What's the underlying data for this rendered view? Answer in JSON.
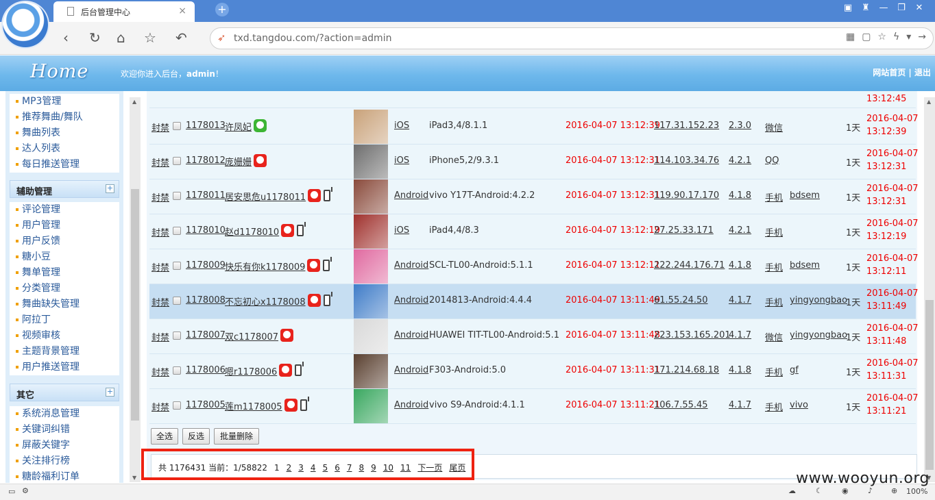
{
  "browser": {
    "tab_title": "后台管理中心",
    "tab_close": "×",
    "new_tab": "+",
    "url": "txd.tangdou.com/?action=admin",
    "zoom": "100%"
  },
  "header": {
    "home": "Home",
    "welcome_prefix": "欢迎你进入后台，",
    "user": "admin",
    "welcome_suffix": "！",
    "links": "网站首页 | 退出"
  },
  "sidebar": {
    "group1_items": [
      "MP3管理",
      "推荐舞曲/舞队",
      "舞曲列表",
      "达人列表",
      "每日推送管理"
    ],
    "group2_title": "辅助管理",
    "group2_items": [
      "评论管理",
      "用户管理",
      "用户反馈",
      "糖小豆",
      "舞单管理",
      "分类管理",
      "舞曲缺失管理",
      "阿拉丁",
      "视频审核",
      "主题背景管理",
      "用户推送管理"
    ],
    "group3_title": "其它",
    "group3_items": [
      "系统消息管理",
      "关键词纠错",
      "屏蔽关键字",
      "关注排行榜",
      "糖龄福利订单"
    ]
  },
  "table": {
    "ban_label": "封禁",
    "days": "1天",
    "top_time": "13:12:45",
    "rows": [
      {
        "id": "1178013",
        "name": "许凤妃",
        "badge": "wechat",
        "phone": false,
        "os": "iOS",
        "device": "iPad3,4/8.1.1",
        "time": "2016-04-07 13:12:39",
        "ip": "117.31.152.23",
        "ver": "2.3.0",
        "login": "微信",
        "channel": "",
        "date": "2016-04-07",
        "clock": "13:12:39",
        "avatar": "#c9a27a",
        "selected": false
      },
      {
        "id": "1178012",
        "name": "庞姗姗",
        "badge": "qq",
        "phone": false,
        "os": "iOS",
        "device": "iPhone5,2/9.3.1",
        "time": "2016-04-07 13:12:31",
        "ip": "114.103.34.76",
        "ver": "4.2.1",
        "login": "QQ",
        "channel": "",
        "date": "2016-04-07",
        "clock": "13:12:31",
        "avatar": "#6e6e6e",
        "selected": false
      },
      {
        "id": "1178011",
        "name": "居安思危u1178011",
        "badge": "qq",
        "phone": true,
        "os": "Android",
        "device": "vivo Y17T-Android:4.2.2",
        "time": "2016-04-07 13:12:31",
        "ip": "119.90.17.170",
        "ver": "4.1.8",
        "login": "手机",
        "channel": "bdsem",
        "date": "2016-04-07",
        "clock": "13:12:31",
        "avatar": "#8a4b3c",
        "selected": false
      },
      {
        "id": "1178010",
        "name": "赵d1178010",
        "badge": "qq",
        "phone": true,
        "os": "iOS",
        "device": "iPad4,4/8.3",
        "time": "2016-04-07 13:12:19",
        "ip": "27.25.33.171",
        "ver": "4.2.1",
        "login": "手机",
        "channel": "",
        "date": "2016-04-07",
        "clock": "13:12:19",
        "avatar": "#a0322e",
        "selected": false
      },
      {
        "id": "1178009",
        "name": "快乐有你k1178009",
        "badge": "qq",
        "phone": true,
        "os": "Android",
        "device": "SCL-TL00-Android:5.1.1",
        "time": "2016-04-07 13:12:11",
        "ip": "222.244.176.71",
        "ver": "4.1.8",
        "login": "手机",
        "channel": "bdsem",
        "date": "2016-04-07",
        "clock": "13:12:11",
        "avatar": "#e06aa0",
        "selected": false
      },
      {
        "id": "1178008",
        "name": "不忘初心x1178008",
        "badge": "qq",
        "phone": true,
        "os": "Android",
        "device": "2014813-Android:4.4.4",
        "time": "2016-04-07 13:11:49",
        "ip": "61.55.24.50",
        "ver": "4.1.7",
        "login": "手机",
        "channel": "yingyongbao",
        "date": "2016-04-07",
        "clock": "13:11:49",
        "avatar": "#3f7cc8",
        "selected": true
      },
      {
        "id": "1178007",
        "name": "双c1178007",
        "badge": "qq",
        "phone": false,
        "os": "Android",
        "device": "HUAWEI TIT-TL00-Android:5.1",
        "time": "2016-04-07 13:11:48",
        "ip": "223.153.165.201",
        "ver": "4.1.7",
        "login": "微信",
        "channel": "yingyongbao",
        "date": "2016-04-07",
        "clock": "13:11:48",
        "avatar": "#d9d9d9",
        "selected": false
      },
      {
        "id": "1178006",
        "name": "嗯r1178006",
        "badge": "qq",
        "phone": true,
        "os": "Android",
        "device": "F303-Android:5.0",
        "time": "2016-04-07 13:11:31",
        "ip": "171.214.68.18",
        "ver": "4.1.8",
        "login": "手机",
        "channel": "gf",
        "date": "2016-04-07",
        "clock": "13:11:31",
        "avatar": "#5a4030",
        "selected": false
      },
      {
        "id": "1178005",
        "name": "莲m1178005",
        "badge": "qq",
        "phone": true,
        "os": "Android",
        "device": "vivo S9-Android:4.1.1",
        "time": "2016-04-07 13:11:21",
        "ip": "106.7.55.45",
        "ver": "4.1.7",
        "login": "手机",
        "channel": "vivo",
        "date": "2016-04-07",
        "clock": "13:11:21",
        "avatar": "#3aa860",
        "selected": false
      }
    ]
  },
  "actions": {
    "select_all": "全选",
    "invert": "反选",
    "batch_delete": "批量删除"
  },
  "pager": {
    "total_label": "共",
    "total": "1176431",
    "current_label": "当前：",
    "current": "1/58822",
    "pages": [
      "1",
      "2",
      "3",
      "4",
      "5",
      "6",
      "7",
      "8",
      "9",
      "10",
      "11"
    ],
    "next": "下一页",
    "last": "尾页"
  },
  "watermark": "www.wooyun.org"
}
